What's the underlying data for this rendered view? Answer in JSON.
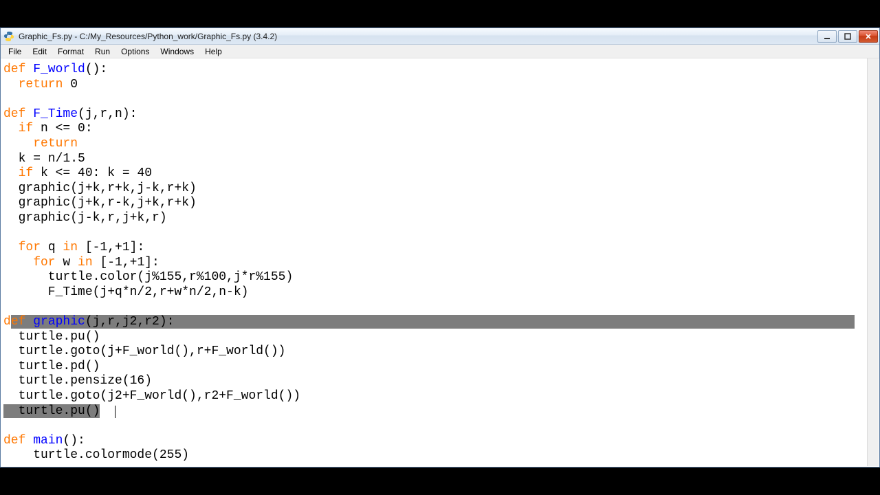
{
  "window": {
    "title": "Graphic_Fs.py - C:/My_Resources/Python_work/Graphic_Fs.py (3.4.2)"
  },
  "menu": {
    "file": "File",
    "edit": "Edit",
    "format": "Format",
    "run": "Run",
    "options": "Options",
    "windows": "Windows",
    "help": "Help"
  },
  "code": {
    "l1_def": "def",
    "l1_name": " F_world",
    "l1_rest": "():",
    "l2_ret": "  return",
    "l2_rest": " 0",
    "blank1": "",
    "l4_def": "def",
    "l4_name": " F_Time",
    "l4_rest": "(j,r,n):",
    "l5_if": "  if",
    "l5_rest": " n <= 0:",
    "l6_ret": "    return",
    "l7": "  k = n/1.5",
    "l8_if": "  if",
    "l8_rest": " k <= 40: k = 40",
    "l9": "  graphic(j+k,r+k,j-k,r+k)",
    "l10": "  graphic(j+k,r-k,j+k,r+k)",
    "l11": "  graphic(j-k,r,j+k,r)",
    "blank2": "",
    "l13_for": "  for",
    "l13_mid": " q ",
    "l13_in": "in",
    "l13_rest": " [-1,+1]:",
    "l14_for": "    for",
    "l14_mid": " w ",
    "l14_in": "in",
    "l14_rest": " [-1,+1]:",
    "l15": "      turtle.color(j%155,r%100,j*r%155)",
    "l16": "      F_Time(j+q*n/2,r+w*n/2,n-k)",
    "blank3": "",
    "sel_l1_d": "d",
    "sel_l1_ef": "ef",
    "sel_l1_name": " graphic",
    "sel_l1_rest": "(j,r,j2,r2):",
    "sel_l2": "  turtle.pu()",
    "sel_l3": "  turtle.goto(j+F_world(),r+F_world())",
    "sel_l4": "  turtle.pd()",
    "sel_l5": "  turtle.pensize(16)",
    "sel_l6": "  turtle.goto(j2+F_world(),r2+F_world())",
    "sel_l7": "  turtle.pu()",
    "after_cursor": "  ",
    "blank4": "",
    "l26_def": "def",
    "l26_name": " main",
    "l26_rest": "():",
    "l27": "    turtle.colormode(255)"
  }
}
